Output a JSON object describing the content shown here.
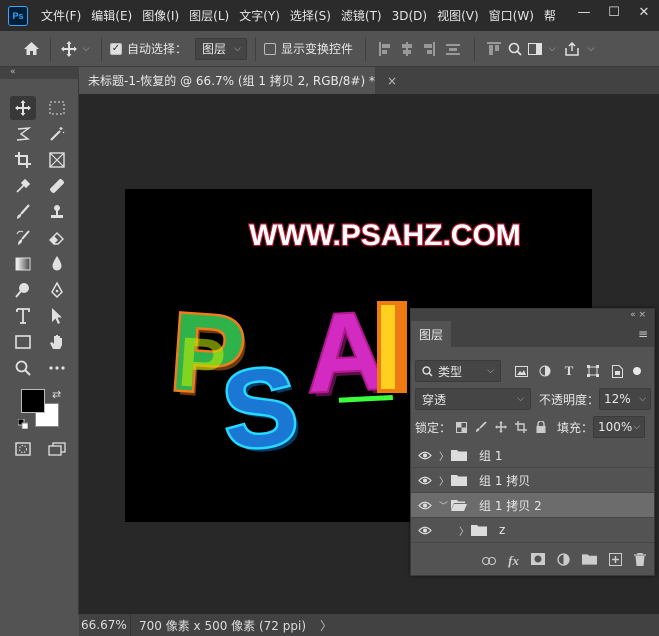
{
  "app": {
    "logo": "Ps"
  },
  "menu": [
    "文件(F)",
    "编辑(E)",
    "图像(I)",
    "图层(L)",
    "文字(Y)",
    "选择(S)",
    "滤镜(T)",
    "3D(D)",
    "视图(V)",
    "窗口(W)",
    "帮"
  ],
  "window_controls": {
    "minimize": "—",
    "maximize": "☐",
    "close": "✕"
  },
  "options": {
    "auto_select_label": "自动选择：",
    "auto_select_checked": true,
    "auto_select_target": "图层",
    "show_transform_label": "显示变换控件",
    "show_transform_checked": false
  },
  "document": {
    "tab_title": "未标题-1-恢复的 @ 66.7% (组 1 拷贝 2, RGB/8#) *",
    "close": "×",
    "canvas_text_top": "WWW.PSAHZ.COM",
    "canvas_text_main": "PSAHZ"
  },
  "status": {
    "zoom": "66.67%",
    "info": "700 像素 x 500 像素 (72 ppi)",
    "arrow": "〉"
  },
  "layers_panel": {
    "tab": "图层",
    "filter_kind": "类型",
    "blend_mode": "穿透",
    "opacity_label": "不透明度：",
    "opacity_value": "12%",
    "lock_label": "锁定：",
    "fill_label": "填充：",
    "fill_value": "100%",
    "layers": [
      {
        "name": "组 1",
        "expanded": false,
        "selected": false,
        "indent": 0
      },
      {
        "name": "组 1 拷贝",
        "expanded": false,
        "selected": false,
        "indent": 0
      },
      {
        "name": "组 1 拷贝 2",
        "expanded": true,
        "selected": true,
        "indent": 0
      },
      {
        "name": "z",
        "expanded": false,
        "selected": false,
        "indent": 1
      }
    ]
  },
  "colors": {
    "foreground": "#000000",
    "background": "#ffffff"
  }
}
